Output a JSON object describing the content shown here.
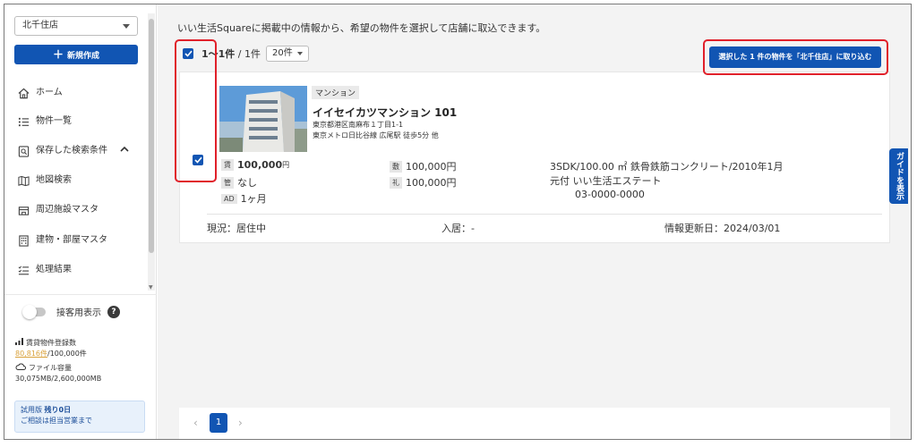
{
  "sidebar": {
    "store_name": "北千住店",
    "new_button": "新規作成",
    "nav": [
      {
        "label": "ホーム",
        "icon": "home-icon"
      },
      {
        "label": "物件一覧",
        "icon": "list-icon"
      },
      {
        "label": "保存した検索条件",
        "icon": "saved-search-icon"
      },
      {
        "label": "地図検索",
        "icon": "map-icon"
      },
      {
        "label": "周辺施設マスタ",
        "icon": "facility-icon"
      },
      {
        "label": "建物・部屋マスタ",
        "icon": "building-icon"
      },
      {
        "label": "処理結果",
        "icon": "checklist-icon"
      }
    ],
    "toggle_label": "接客用表示",
    "help_glyph": "?",
    "listing_count_label": "賃貸物件登録数",
    "listing_count_used": "80,816件",
    "listing_count_total": "/100,000件",
    "storage_label": "ファイル容量",
    "storage_value": "30,075MB/2,600,000MB",
    "trial_prefix": "試用版",
    "trial_remaining": "残り0日",
    "trial_note": "ご相談は担当営業まで"
  },
  "main": {
    "notice": "いい生活Squareに掲載中の情報から、希望の物件を選択して店舗に取込できます。",
    "result_range": "1〜1件",
    "result_total": " / 1件",
    "per_page": "20件",
    "import_button": "選択した 1 件の物件を「北千住店」に取り込む"
  },
  "property": {
    "type": "マンション",
    "name": "イイセイカツマンション 101",
    "address": "東京都港区南麻布１丁目1-1",
    "station": "東京メトロ日比谷線 広尾駅 徒歩5分 他",
    "rent_tag": "賃",
    "rent_value": "100,000",
    "rent_unit": "円",
    "mgmt_tag": "管",
    "mgmt_value": "なし",
    "ad_tag": "AD",
    "ad_value": "1ヶ月",
    "deposit_tag": "敷",
    "deposit_value": "100,000円",
    "keymoney_tag": "礼",
    "keymoney_value": "100,000円",
    "spec": "3SDK/100.00 ㎡ 鉄骨鉄筋コンクリート/2010年1月",
    "agent": "元付 いい生活エステート",
    "phone": "03-0000-0000",
    "status": "現況：居住中",
    "move_in": "入居：-",
    "updated": "情報更新日：2024/03/01"
  },
  "pagination": {
    "prev": "‹",
    "current": "1",
    "next": "›"
  },
  "guide_tab": "ガイドを表示",
  "colors": {
    "primary": "#1155b3",
    "highlight": "#e0202a"
  }
}
